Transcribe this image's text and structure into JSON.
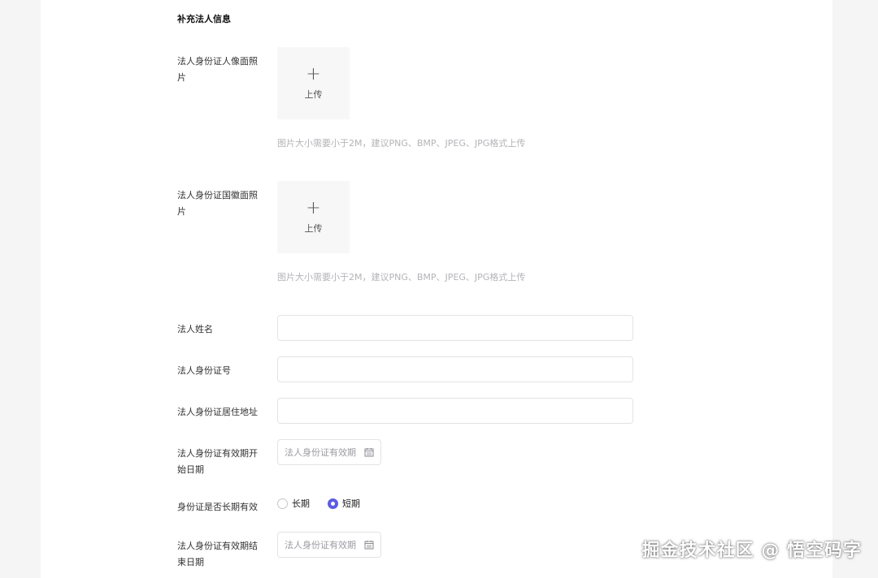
{
  "section": {
    "title": "补充法人信息"
  },
  "fields": {
    "id_front": {
      "label_line1": "法人身份证人像面照",
      "label_line2": "片",
      "upload_plus": "+",
      "upload_label": "上传",
      "hint": "图片大小需要小于2M，建议PNG、BMP、JPEG、JPG格式上传"
    },
    "id_back": {
      "label_line1": "法人身份证国徽面照",
      "label_line2": "片",
      "upload_plus": "+",
      "upload_label": "上传",
      "hint": "图片大小需要小于2M，建议PNG、BMP、JPEG、JPG格式上传"
    },
    "name": {
      "label": "法人姓名",
      "value": ""
    },
    "id_number": {
      "label": "法人身份证号",
      "value": ""
    },
    "address": {
      "label": "法人身份证居住地址",
      "value": ""
    },
    "start_date": {
      "label_line1": "法人身份证有效期开",
      "label_line2": "始日期",
      "placeholder": "法人身份证有效期"
    },
    "long_term": {
      "label": "身份证是否长期有效",
      "options": [
        "长期",
        "短期"
      ],
      "selected": "短期"
    },
    "end_date": {
      "label_line1": "法人身份证有效期结",
      "label_line2": "束日期",
      "placeholder": "法人身份证有效期"
    }
  },
  "watermark": "掘金技术社区 @ 悟空码字",
  "colors": {
    "accent": "#5b5ce2",
    "border": "#e3e3e6",
    "hint": "#b4b4b8"
  }
}
